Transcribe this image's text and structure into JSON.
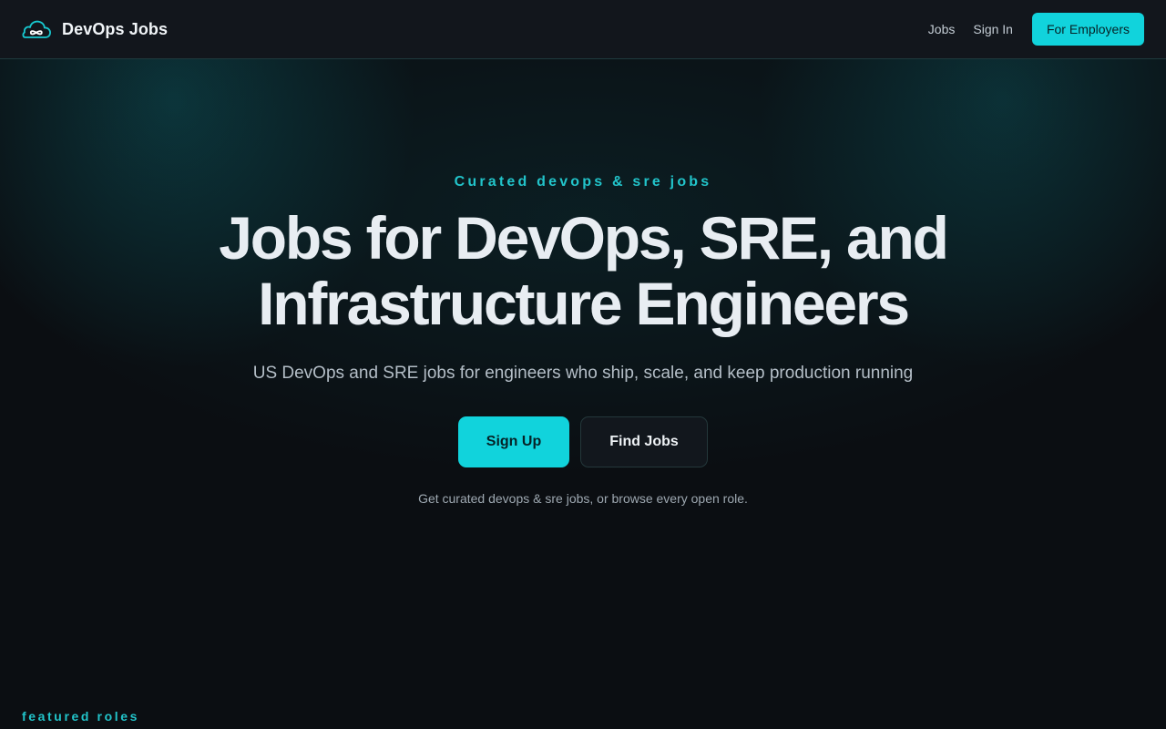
{
  "header": {
    "brand_name": "DevOps Jobs",
    "logo_icon": "cloud-infinity-icon",
    "nav": {
      "jobs_label": "Jobs",
      "signin_label": "Sign In",
      "employers_label": "For Employers"
    }
  },
  "hero": {
    "eyebrow": "Curated devops & sre jobs",
    "headline_line1": "Jobs for DevOps, SRE, and",
    "headline_line2": "Infrastructure Engineers",
    "subhead": "US DevOps and SRE jobs for engineers who ship, scale, and keep production running",
    "signup_label": "Sign Up",
    "findjobs_label": "Find Jobs",
    "note": "Get curated devops & sre jobs, or browse every open role."
  },
  "featured": {
    "label": "featured roles"
  },
  "colors": {
    "accent": "#11d3dc",
    "background": "#0b0e12",
    "header": "#12161c"
  }
}
